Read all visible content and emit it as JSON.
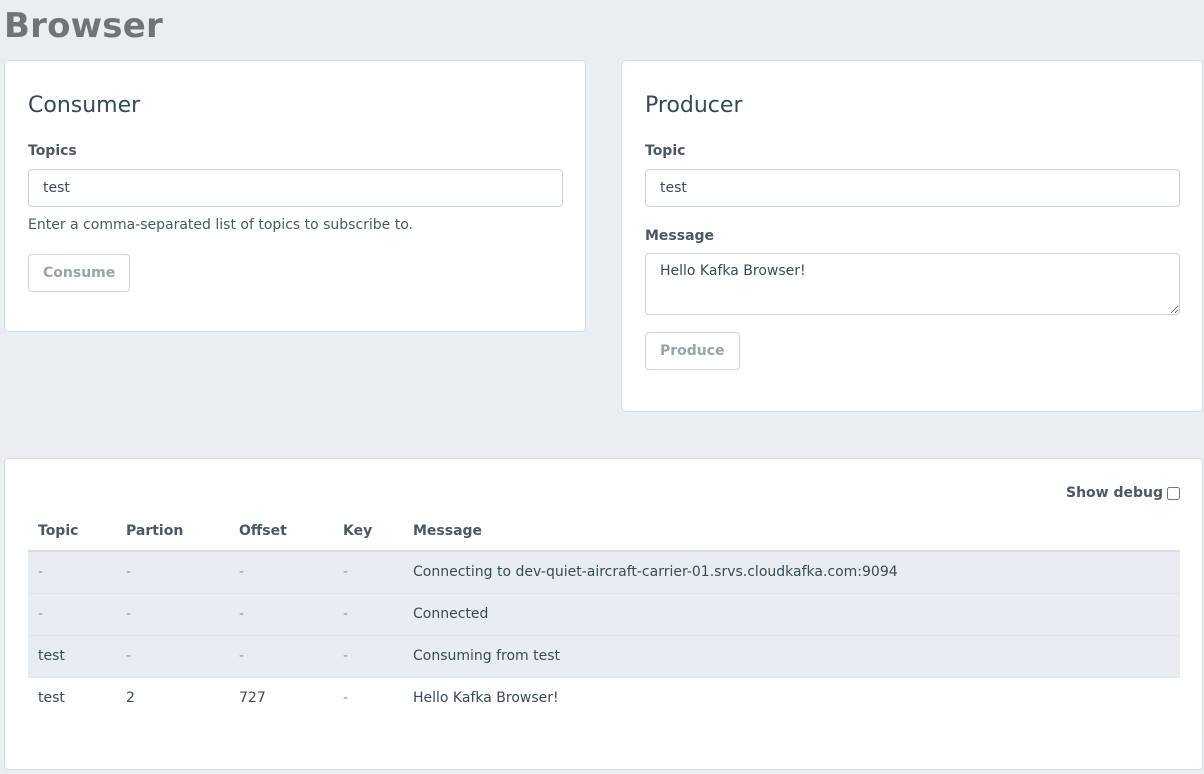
{
  "page": {
    "title": "Browser"
  },
  "consumer": {
    "title": "Consumer",
    "topics_label": "Topics",
    "topics_value": "test",
    "help": "Enter a comma-separated list of topics to subscribe to.",
    "button": "Consume"
  },
  "producer": {
    "title": "Producer",
    "topic_label": "Topic",
    "topic_value": "test",
    "message_label": "Message",
    "message_value": "Hello Kafka Browser!",
    "button": "Produce"
  },
  "log": {
    "show_debug_label": "Show debug",
    "show_debug_checked": false,
    "columns": [
      "Topic",
      "Partion",
      "Offset",
      "Key",
      "Message"
    ],
    "rows": [
      {
        "topic": "-",
        "partition": "-",
        "offset": "-",
        "key": "-",
        "message": "Connecting to dev-quiet-aircraft-carrier-01.srvs.cloudkafka.com:9094"
      },
      {
        "topic": "-",
        "partition": "-",
        "offset": "-",
        "key": "-",
        "message": "Connected"
      },
      {
        "topic": "test",
        "partition": "-",
        "offset": "-",
        "key": "-",
        "message": "Consuming from test"
      },
      {
        "topic": "test",
        "partition": "2",
        "offset": "727",
        "key": "-",
        "message": "Hello Kafka Browser!"
      }
    ]
  },
  "colors": {
    "page_background": "#e9eef2",
    "card_background": "#ffffff",
    "title_text": "#34495e",
    "shaded_row": "#e7edf2"
  }
}
